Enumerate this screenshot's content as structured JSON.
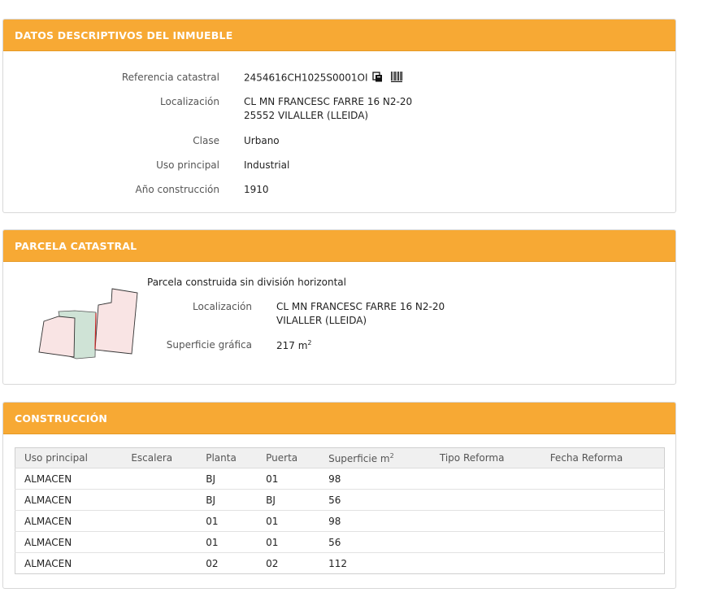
{
  "datos": {
    "title": "DATOS DESCRIPTIVOS DEL INMUEBLE",
    "referencia_label": "Referencia catastral",
    "referencia_value": "2454616CH1025S0001OI",
    "localizacion_label": "Localización",
    "localizacion_line1": "CL MN FRANCESC FARRE 16 N2-20",
    "localizacion_line2": "25552 VILALLER (LLEIDA)",
    "clase_label": "Clase",
    "clase_value": "Urbano",
    "uso_label": "Uso principal",
    "uso_value": "Industrial",
    "anio_label": "Año construcción",
    "anio_value": "1910",
    "icons": [
      "copy-icon",
      "barcode-icon"
    ]
  },
  "parcela": {
    "title": "PARCELA CATASTRAL",
    "subtitle": "Parcela construida sin división horizontal",
    "localizacion_label": "Localización",
    "localizacion_line1": "CL MN FRANCESC FARRE 16 N2-20",
    "localizacion_line2": "VILALLER (LLEIDA)",
    "superficie_label": "Superficie gráfica",
    "superficie_value": "217 m",
    "superficie_unit_sup": "2",
    "map_colors": {
      "parcel_fill": "#f9e4e4",
      "neighbor_fill": "#cfe3d6",
      "border": "#cc2a2a"
    }
  },
  "construccion": {
    "title": "CONSTRUCCIÓN",
    "headers": {
      "uso": "Uso principal",
      "escalera": "Escalera",
      "planta": "Planta",
      "puerta": "Puerta",
      "superficie": "Superficie m",
      "superficie_sup": "2",
      "tipo": "Tipo Reforma",
      "fecha": "Fecha Reforma"
    },
    "rows": [
      {
        "uso": "ALMACEN",
        "escalera": "",
        "planta": "BJ",
        "puerta": "01",
        "superficie": "98",
        "tipo": "",
        "fecha": ""
      },
      {
        "uso": "ALMACEN",
        "escalera": "",
        "planta": "BJ",
        "puerta": "BJ",
        "superficie": "56",
        "tipo": "",
        "fecha": ""
      },
      {
        "uso": "ALMACEN",
        "escalera": "",
        "planta": "01",
        "puerta": "01",
        "superficie": "98",
        "tipo": "",
        "fecha": ""
      },
      {
        "uso": "ALMACEN",
        "escalera": "",
        "planta": "01",
        "puerta": "01",
        "superficie": "56",
        "tipo": "",
        "fecha": ""
      },
      {
        "uso": "ALMACEN",
        "escalera": "",
        "planta": "02",
        "puerta": "02",
        "superficie": "112",
        "tipo": "",
        "fecha": ""
      }
    ]
  },
  "theme": {
    "accent": "#f7a934",
    "border": "#d8d8d8"
  }
}
